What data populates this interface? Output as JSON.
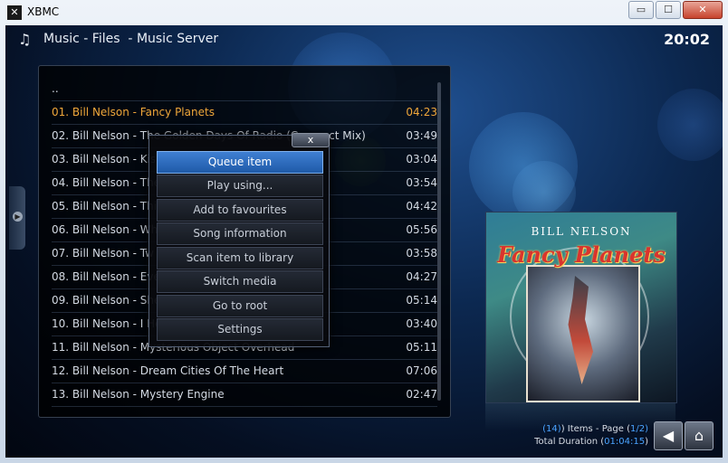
{
  "window": {
    "title": "XBMC",
    "icon": "xbmc-logo-icon",
    "buttons": {
      "minimize": "▭",
      "maximize": "☐",
      "close": "✕"
    }
  },
  "header": {
    "section": "Music",
    "sep1": " - ",
    "view": "Files",
    "sep2": "  - ",
    "source": "Music Server",
    "clock": "20:02"
  },
  "list": {
    "items": [
      {
        "title": "..",
        "duration": ""
      },
      {
        "title": "01. Bill Nelson - Fancy Planets",
        "duration": "04:23",
        "selected": true
      },
      {
        "title": "02. Bill Nelson - The Golden Days Of Radio (Compact Mix)",
        "duration": "03:49"
      },
      {
        "title": "03. Bill Nelson - Kis",
        "duration": "03:04"
      },
      {
        "title": "04. Bill Nelson - The",
        "duration": "03:54"
      },
      {
        "title": "05. Bill Nelson - Thi",
        "duration": "04:42"
      },
      {
        "title": "06. Bill Nelson - Wh",
        "duration": "05:56"
      },
      {
        "title": "07. Bill Nelson - Tw",
        "duration": "03:58"
      },
      {
        "title": "08. Bill Nelson - Eve",
        "duration": "04:27"
      },
      {
        "title": "09. Bill Nelson - She",
        "duration": "05:14"
      },
      {
        "title": "10. Bill Nelson - I He",
        "duration": "03:40"
      },
      {
        "title": "11. Bill Nelson - Mysterious Object Overhead",
        "duration": "05:11"
      },
      {
        "title": "12. Bill Nelson - Dream Cities Of The Heart",
        "duration": "07:06"
      },
      {
        "title": "13. Bill Nelson - Mystery Engine",
        "duration": "02:47"
      }
    ]
  },
  "context_menu": {
    "close_label": "x",
    "items": [
      "Queue item",
      "Play using...",
      "Add to favourites",
      "Song information",
      "Scan item to library",
      "Switch media",
      "Go to root",
      "Settings"
    ],
    "focused": "Queue item"
  },
  "cover": {
    "artist": "BILL NELSON",
    "album": "Fancy Planets"
  },
  "footer": {
    "items_open": "(",
    "items_count": "14",
    "items_mid": ") Items - Page (",
    "page": "1/2",
    "items_close": ")",
    "duration_label": "Total Duration (",
    "duration": "01:04:15",
    "duration_close": ")",
    "back_icon": "back-arrow-icon",
    "home_icon": "home-icon"
  },
  "colors": {
    "selected_text": "#f0a73a",
    "highlight": "#4aa3ff",
    "focus": "#2a6bc2"
  }
}
